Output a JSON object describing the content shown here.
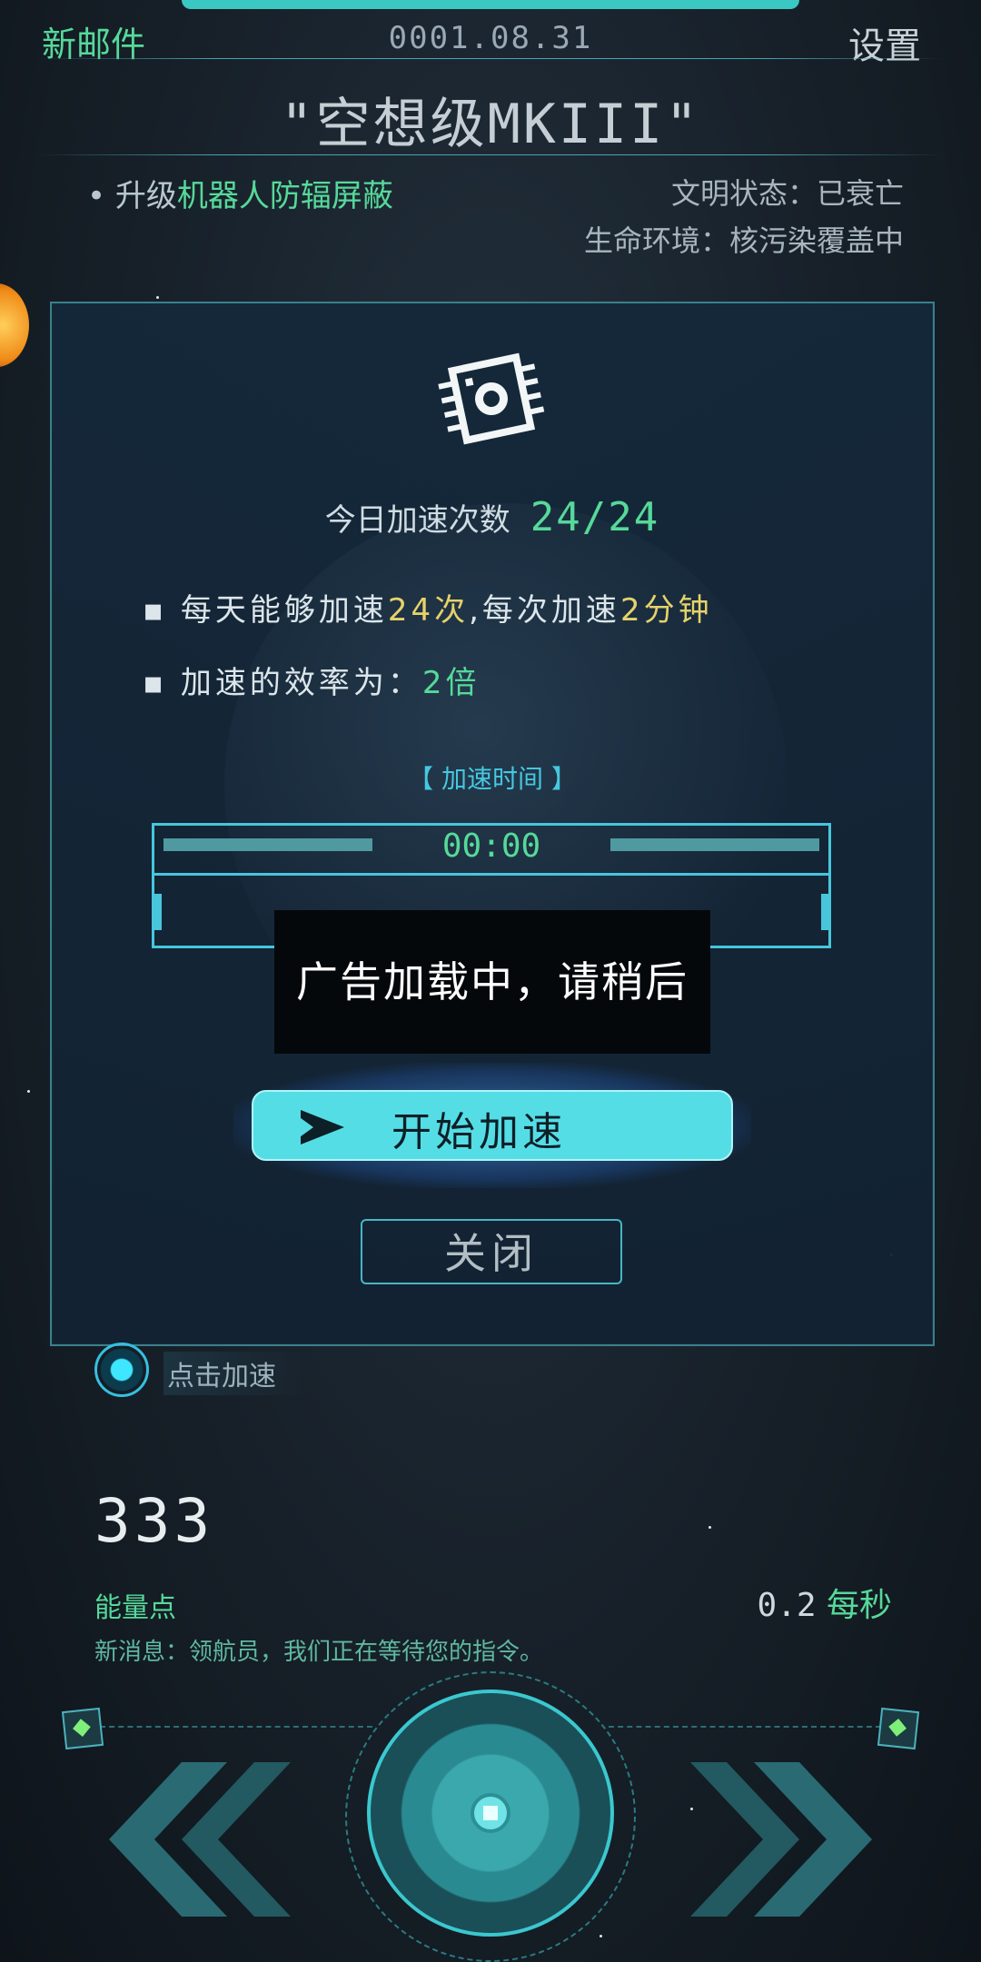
{
  "header": {
    "new_mail": "新邮件",
    "date": "0001.08.31",
    "settings": "设置",
    "ship_title": "\"空想级MKIII\""
  },
  "info": {
    "upgrade_prefix": "• 升级",
    "upgrade_item": "机器人防辐屏蔽",
    "civ_status": "文明状态：已衰亡",
    "life_env": "生命环境：核污染覆盖中"
  },
  "dialog": {
    "accel_label": "今日加速次数",
    "accel_count": "24/24",
    "bullet1_a": "▪ 每天能够加速",
    "bullet1_b": "24次",
    "bullet1_c": ",每次加速",
    "bullet1_d": "2分钟",
    "bullet2_a": "▪ 加速的效率为：",
    "bullet2_b": "2倍",
    "time_label": "【 加速时间 】",
    "timer": "00:00",
    "toast": "广告加载中，请稍后",
    "start_button": "开始加速",
    "close_button": "关闭"
  },
  "below": {
    "tap_accel": "点击加速",
    "energy_value": "333",
    "energy_label": "能量点",
    "rate_value": "0.2",
    "rate_unit": "每秒",
    "message": "新消息：领航员，我们正在等待您的指令。"
  },
  "colors": {
    "accent_green": "#56d99a",
    "accent_cyan": "#47c6dc",
    "highlight_yellow": "#e6d26a",
    "button_cyan": "#55dde6"
  },
  "icons": [
    "chip-icon",
    "play-arrow-icon",
    "double-left-arrow-icon",
    "double-right-arrow-icon",
    "center-core-button-icon"
  ]
}
